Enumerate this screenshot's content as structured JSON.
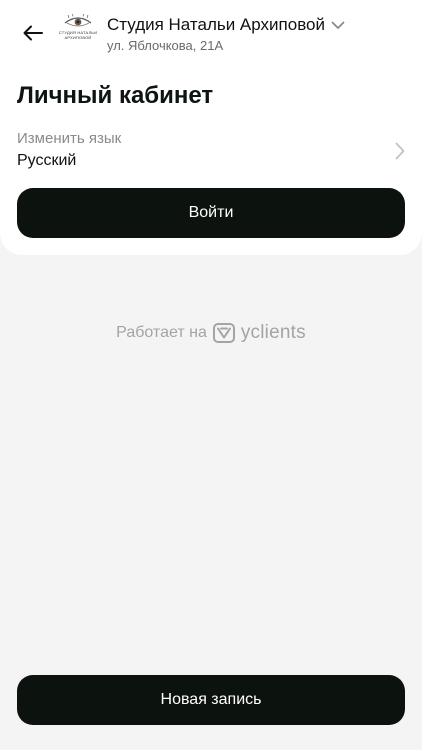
{
  "header": {
    "studio_name": "Студия Натальи Архиповой",
    "address": "ул. Яблочкова, 21А",
    "logo_text": "СТУДИЯ НАТАЛЬИ АРХИПОВОЙ"
  },
  "page": {
    "title": "Личный кабинет"
  },
  "language": {
    "label": "Изменить язык",
    "value": "Русский"
  },
  "buttons": {
    "login": "Войти",
    "new_booking": "Новая запись"
  },
  "footer": {
    "powered_by": "Работает на",
    "brand": "yclients"
  },
  "icons": {
    "back": "arrow-left-icon",
    "studio_dropdown": "chevron-down-icon",
    "language_next": "chevron-right-icon",
    "brand": "yclients-logo-icon"
  }
}
